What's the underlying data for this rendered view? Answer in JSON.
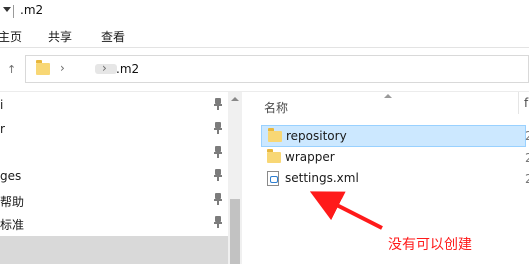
{
  "window": {
    "title": ".m2"
  },
  "ribbon": {
    "tabs": [
      "主页",
      "共享",
      "查看"
    ]
  },
  "address_bar": {
    "current_folder": ".m2"
  },
  "nav_pane": {
    "items": [
      {
        "label": "i"
      },
      {
        "label": "r"
      },
      {
        "label": ""
      },
      {
        "label": "ges"
      },
      {
        "label": "帮助"
      },
      {
        "label": "标准"
      }
    ]
  },
  "file_list": {
    "column_name": "名称",
    "column_next": "f",
    "items": [
      {
        "name": "repository",
        "type": "folder",
        "date_fragment": "2"
      },
      {
        "name": "wrapper",
        "type": "folder",
        "date_fragment": "2"
      },
      {
        "name": "settings.xml",
        "type": "xml-file",
        "date_fragment": "2"
      }
    ]
  },
  "annotation": {
    "text": "没有可以创建",
    "color": "#ff1a1a"
  }
}
